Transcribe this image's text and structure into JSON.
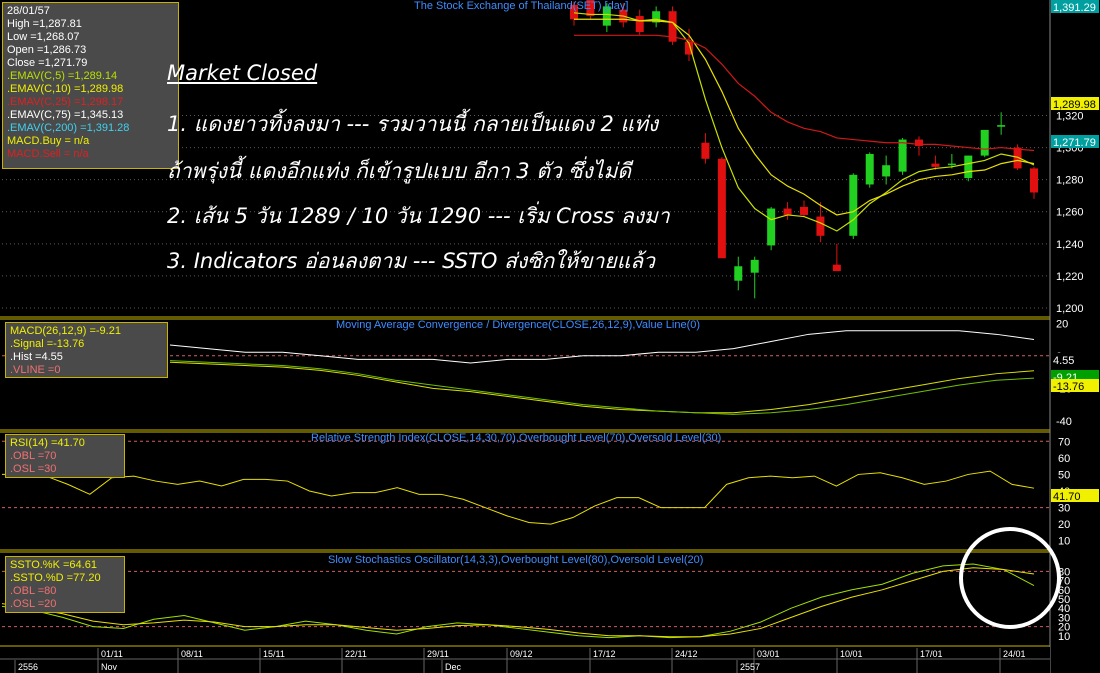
{
  "colors": {
    "bg": "#000000",
    "up": "#22d022",
    "down": "#e01010",
    "ema5": "#c8e000",
    "ema10": "#e8e000",
    "ema25": "#d01818",
    "grid": "#5a5a5a",
    "sep": "#c8b400"
  },
  "chart_title": "The Stock Exchange of Thailand(SET) [day]",
  "info": {
    "date": "28/01/57",
    "high": "High =1,287.81",
    "low": "Low =1,268.07",
    "open": "Open =1,286.73",
    "close": "Close =1,271.79",
    "ema5": ".EMAV(C,5) =1,289.14",
    "ema10": ".EMAV(C,10) =1,289.98",
    "ema25": ".EMAV(C,25) =1,298.17",
    "ema75": ".EMAV(C,75) =1,345.13",
    "ema200": ".EMAV(C,200) =1,391.28",
    "macd_buy": "MACD.Buy = n/a",
    "macd_sell": "MACD.Sell = n/a"
  },
  "notes": {
    "heading": "Market Closed",
    "line1": "1. แดงยาวทิ้งลงมา --- รวมวานนี้ กลายเป็นแดง 2 แท่ง",
    "line2": "ถ้าพรุ่งนี้ แดงอีกแท่ง ก็เข้ารูปแบบ อีกา 3 ตัว ซึ่งไม่ดี",
    "line3": "2. เส้น 5 วัน 1289 / 10 วัน 1290 --- เริ่ม Cross ลงมา",
    "line4": "3. Indicators อ่อนลงตาม --- SSTO ส่งซิกให้ขายแล้ว"
  },
  "macd": {
    "title": "Moving Average Convergence / Divergence(CLOSE,26,12,9),Value Line(0)",
    "l1": "MACD(26,12,9) =-9.21",
    "l2": ".Signal =-13.76",
    "l3": ".Hist =4.55",
    "l4": ".VLINE =0"
  },
  "rsi": {
    "title": "Relative Strength Index(CLOSE,14,30,70),Overbought Level(70),Oversold Level(30)",
    "l1": "RSI(14) =41.70",
    "l2": ".OBL =70",
    "l3": ".OSL =30"
  },
  "ssto": {
    "title": "Slow Stochastics Oscillator(14,3,3),Overbought Level(80),Oversold Level(20)",
    "l1": "SSTO.%K =64.61",
    "l2": ".SSTO.%D =77.20",
    "l3": ".OBL =80",
    "l4": ".OSL =20"
  },
  "axis": {
    "price_ticks": [
      "1,320",
      "1,300",
      "1,280",
      "1,260",
      "1,240",
      "1,220",
      "1,200"
    ],
    "price_tags": [
      "1,391.29",
      "1,289.98",
      "1,271.79"
    ],
    "macd_ticks": [
      "20",
      "0",
      "-20",
      "-40"
    ],
    "macd_tags": [
      "4.55",
      "-9.21",
      "-13.76"
    ],
    "rsi_ticks": [
      "70",
      "60",
      "50",
      "40",
      "30",
      "20",
      "10"
    ],
    "rsi_tag": "41.70",
    "ssto_ticks": [
      "80",
      "70",
      "60",
      "50",
      "40",
      "30",
      "20",
      "10"
    ],
    "date_ticks": [
      "01/11",
      "08/11",
      "15/11",
      "22/11",
      "29/11",
      "09/12",
      "17/12",
      "24/12",
      "03/01",
      "10/01",
      "17/01",
      "24/01"
    ],
    "period_labels": [
      "2556",
      "Nov",
      "Dec",
      "2557"
    ]
  },
  "chart_data": [
    {
      "type": "candlestick",
      "title": "The Stock Exchange of Thailand(SET) [day]",
      "ylim": [
        1195,
        1392
      ],
      "candles": [
        {
          "o": 1389,
          "h": 1391,
          "l": 1376,
          "c": 1380
        },
        {
          "o": 1392,
          "h": 1392,
          "l": 1380,
          "c": 1382
        },
        {
          "o": 1376,
          "h": 1390,
          "l": 1372,
          "c": 1388
        },
        {
          "o": 1386,
          "h": 1390,
          "l": 1375,
          "c": 1378
        },
        {
          "o": 1382,
          "h": 1386,
          "l": 1370,
          "c": 1372
        },
        {
          "o": 1378,
          "h": 1388,
          "l": 1375,
          "c": 1385
        },
        {
          "o": 1385,
          "h": 1388,
          "l": 1364,
          "c": 1366
        },
        {
          "o": 1366,
          "h": 1374,
          "l": 1354,
          "c": 1358
        },
        {
          "o": 1303,
          "h": 1309,
          "l": 1290,
          "c": 1293
        },
        {
          "o": 1293,
          "h": 1294,
          "l": 1271,
          "c": 1231
        },
        {
          "o": 1217,
          "h": 1232,
          "l": 1211,
          "c": 1226
        },
        {
          "o": 1222,
          "h": 1232,
          "l": 1206,
          "c": 1230
        },
        {
          "o": 1239,
          "h": 1263,
          "l": 1236,
          "c": 1262
        },
        {
          "o": 1262,
          "h": 1266,
          "l": 1255,
          "c": 1258
        },
        {
          "o": 1263,
          "h": 1267,
          "l": 1257,
          "c": 1258
        },
        {
          "o": 1257,
          "h": 1266,
          "l": 1241,
          "c": 1245
        },
        {
          "o": 1227,
          "h": 1240,
          "l": 1225,
          "c": 1223
        },
        {
          "o": 1245,
          "h": 1284,
          "l": 1243,
          "c": 1283
        },
        {
          "o": 1277,
          "h": 1297,
          "l": 1275,
          "c": 1296
        },
        {
          "o": 1282,
          "h": 1295,
          "l": 1277,
          "c": 1289
        },
        {
          "o": 1285,
          "h": 1306,
          "l": 1283,
          "c": 1305
        },
        {
          "o": 1305,
          "h": 1307,
          "l": 1295,
          "c": 1301
        },
        {
          "o": 1290,
          "h": 1295,
          "l": 1286,
          "c": 1288
        },
        {
          "o": 1290,
          "h": 1296,
          "l": 1287,
          "c": 1290
        },
        {
          "o": 1281,
          "h": 1295,
          "l": 1279,
          "c": 1295
        },
        {
          "o": 1295,
          "h": 1311,
          "l": 1294,
          "c": 1311
        },
        {
          "o": 1313,
          "h": 1322,
          "l": 1308,
          "c": 1314
        },
        {
          "o": 1300,
          "h": 1302,
          "l": 1286,
          "c": 1287
        },
        {
          "o": 1287,
          "h": 1288,
          "l": 1268,
          "c": 1272
        }
      ],
      "series": [
        {
          "name": ".EMAV(C,5)",
          "values": [
            1384,
            1383,
            1383,
            1382,
            1379,
            1380,
            1378,
            1365,
            1330,
            1300,
            1275,
            1262,
            1255,
            1258,
            1257,
            1253,
            1248,
            1255,
            1265,
            1272,
            1280,
            1285,
            1287,
            1288,
            1290,
            1292,
            1296,
            1294,
            1289.14
          ]
        },
        {
          "name": ".EMAV(C,10)",
          "values": [
            1380,
            1380,
            1380,
            1380,
            1379,
            1379,
            1378,
            1370,
            1355,
            1335,
            1312,
            1296,
            1283,
            1276,
            1271,
            1264,
            1258,
            1260,
            1267,
            1271,
            1276,
            1280,
            1282,
            1283,
            1285,
            1286,
            1290,
            1292,
            1289.98
          ]
        },
        {
          "name": ".EMAV(C,25)",
          "values": [
            1370,
            1370,
            1370,
            1370,
            1370,
            1370,
            1369,
            1367,
            1362,
            1352,
            1340,
            1332,
            1322,
            1316,
            1312,
            1310,
            1306,
            1305,
            1304,
            1303,
            1303,
            1302,
            1302,
            1301,
            1300,
            1299,
            1300,
            1299,
            1298.17
          ]
        }
      ]
    },
    {
      "type": "line",
      "title": "Moving Average Convergence / Divergence(CLOSE,26,12,9),Value Line(0)",
      "ylim": [
        -45,
        22
      ],
      "series": [
        {
          "name": "MACD(26,12,9)",
          "values": [
            -4,
            -5,
            -6,
            -7,
            -9,
            -12,
            -16,
            -20,
            -22,
            -25,
            -28,
            -31,
            -33,
            -34,
            -35,
            -35,
            -33,
            -30,
            -26,
            -22,
            -18,
            -14,
            -11,
            -9.21
          ]
        },
        {
          "name": ".Signal",
          "values": [
            -3,
            -4,
            -5,
            -6,
            -8,
            -11,
            -15,
            -18,
            -21,
            -24,
            -27,
            -30,
            -32,
            -34,
            -35,
            -36,
            -35,
            -33,
            -30,
            -26,
            -22,
            -18,
            -15,
            -13.76
          ]
        },
        {
          "name": ".Hist",
          "values": [
            3,
            2,
            1,
            1,
            0,
            -1,
            -1,
            -1,
            -2,
            -1,
            -1,
            0,
            0,
            1,
            1,
            2,
            4,
            6,
            7,
            7,
            7,
            7,
            6,
            4.55
          ]
        },
        {
          "name": ".VLINE",
          "values": [
            0,
            0,
            0,
            0,
            0,
            0,
            0,
            0,
            0,
            0,
            0,
            0,
            0,
            0,
            0,
            0,
            0,
            0,
            0,
            0,
            0,
            0,
            0,
            0
          ]
        }
      ]
    },
    {
      "type": "line",
      "title": "Relative Strength Index(CLOSE,14,30,70),Overbought Level(70),Oversold Level(30)",
      "ylim": [
        5,
        75
      ],
      "series": [
        {
          "name": "RSI(14)",
          "values": [
            50,
            50,
            49,
            44,
            38,
            48,
            49,
            46,
            44,
            46,
            43,
            47,
            47,
            46,
            40,
            37,
            39,
            39,
            42,
            38,
            38,
            35,
            30,
            25,
            21,
            20,
            24,
            31,
            36,
            36,
            30,
            30,
            30,
            44,
            48,
            49,
            48,
            49,
            43,
            50,
            51,
            48,
            44,
            46,
            50,
            52,
            44,
            41.7
          ]
        }
      ],
      "levels": [
        70,
        30
      ]
    },
    {
      "type": "line",
      "title": "Slow Stochastics Oscillator(14,3,3),Overbought Level(80),Oversold Level(20)",
      "ylim": [
        0,
        100
      ],
      "series": [
        {
          "name": "SSTO.%K",
          "values": [
            42,
            38,
            30,
            20,
            18,
            28,
            32,
            24,
            16,
            20,
            26,
            22,
            16,
            12,
            20,
            24,
            22,
            18,
            14,
            10,
            8,
            10,
            8,
            9,
            15,
            25,
            40,
            52,
            60,
            66,
            78,
            86,
            88,
            82,
            64.61
          ]
        },
        {
          "name": ".SSTO.%D",
          "values": [
            45,
            40,
            34,
            26,
            22,
            24,
            27,
            25,
            20,
            20,
            22,
            22,
            19,
            16,
            18,
            21,
            22,
            20,
            17,
            13,
            10,
            10,
            9,
            9,
            12,
            18,
            30,
            42,
            52,
            60,
            70,
            80,
            84,
            82,
            77.2
          ]
        }
      ],
      "levels": [
        80,
        20
      ]
    }
  ]
}
